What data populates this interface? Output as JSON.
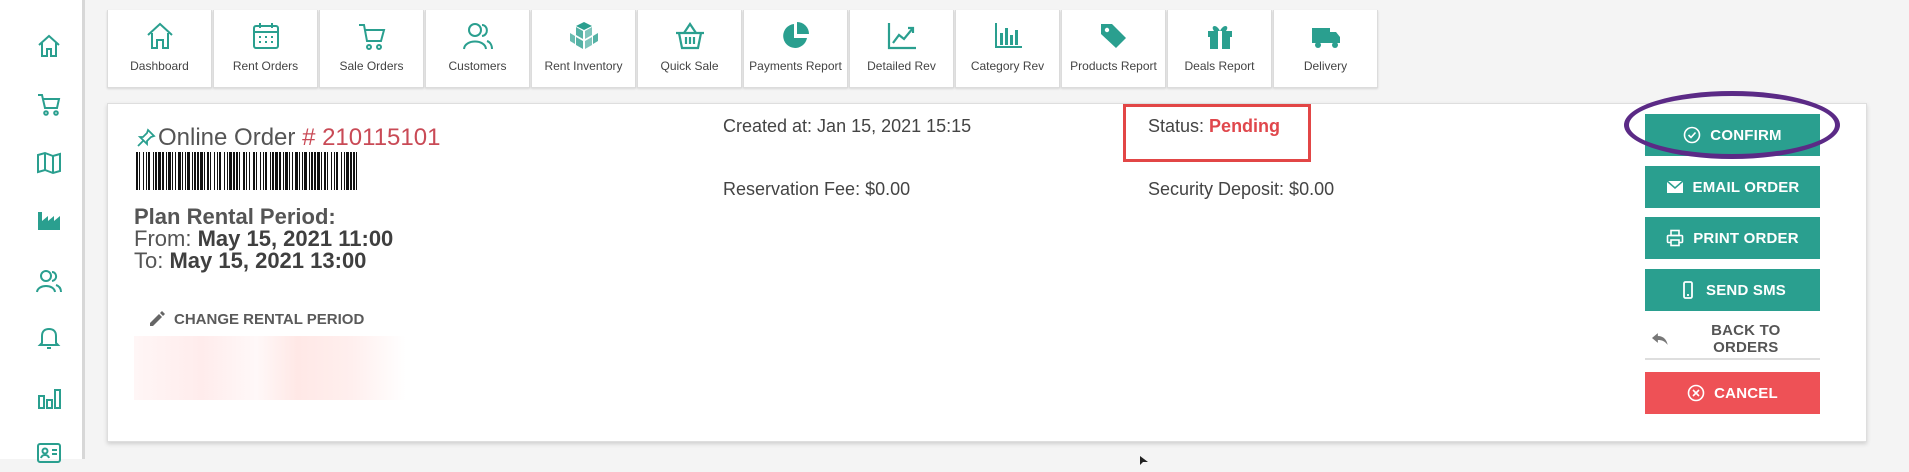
{
  "colors": {
    "accent": "#2a9f8f",
    "order_number": "#c94a56",
    "status_pending": "#e0474c",
    "status_box": "#e24646",
    "confirm_ring": "#5b2a86",
    "cancel": "#ee5156"
  },
  "sidebar": {
    "items": [
      {
        "icon": "home-icon"
      },
      {
        "icon": "cart-icon"
      },
      {
        "icon": "map-icon"
      },
      {
        "icon": "factory-icon"
      },
      {
        "icon": "users-icon"
      },
      {
        "icon": "bell-icon"
      },
      {
        "icon": "bar-chart-icon"
      },
      {
        "icon": "id-card-icon"
      }
    ]
  },
  "toolbar": {
    "items": [
      {
        "label": "Dashboard",
        "icon": "home-icon"
      },
      {
        "label": "Rent Orders",
        "icon": "calendar-icon"
      },
      {
        "label": "Sale Orders",
        "icon": "cart-icon"
      },
      {
        "label": "Customers",
        "icon": "users-icon"
      },
      {
        "label": "Rent Inventory",
        "icon": "boxes-icon"
      },
      {
        "label": "Quick Sale",
        "icon": "basket-icon"
      },
      {
        "label": "Payments Report",
        "icon": "pie-chart-icon"
      },
      {
        "label": "Detailed Rev",
        "icon": "line-chart-icon"
      },
      {
        "label": "Category Rev",
        "icon": "bar-chart-icon"
      },
      {
        "label": "Products Report",
        "icon": "tags-icon"
      },
      {
        "label": "Deals Report",
        "icon": "gift-icon"
      },
      {
        "label": "Delivery",
        "icon": "truck-icon"
      }
    ]
  },
  "order": {
    "title_prefix": "Online Order",
    "number": "# 210115101",
    "plan_heading": "Plan Rental Period:",
    "from_label": "From:",
    "from_value": "May 15, 2021 11:00",
    "to_label": "To:",
    "to_value": "May 15, 2021 13:00",
    "change_period": "CHANGE RENTAL PERIOD",
    "created_at": "Created at: Jan 15, 2021 15:15",
    "reservation_fee": "Reservation Fee: $0.00",
    "status_label": "Status:",
    "status_value": "Pending",
    "security_deposit": "Security Deposit: $0.00"
  },
  "actions": {
    "confirm": "CONFIRM",
    "email": "EMAIL ORDER",
    "print": "PRINT ORDER",
    "sms": "SEND SMS",
    "back": "BACK TO ORDERS",
    "cancel": "CANCEL"
  }
}
